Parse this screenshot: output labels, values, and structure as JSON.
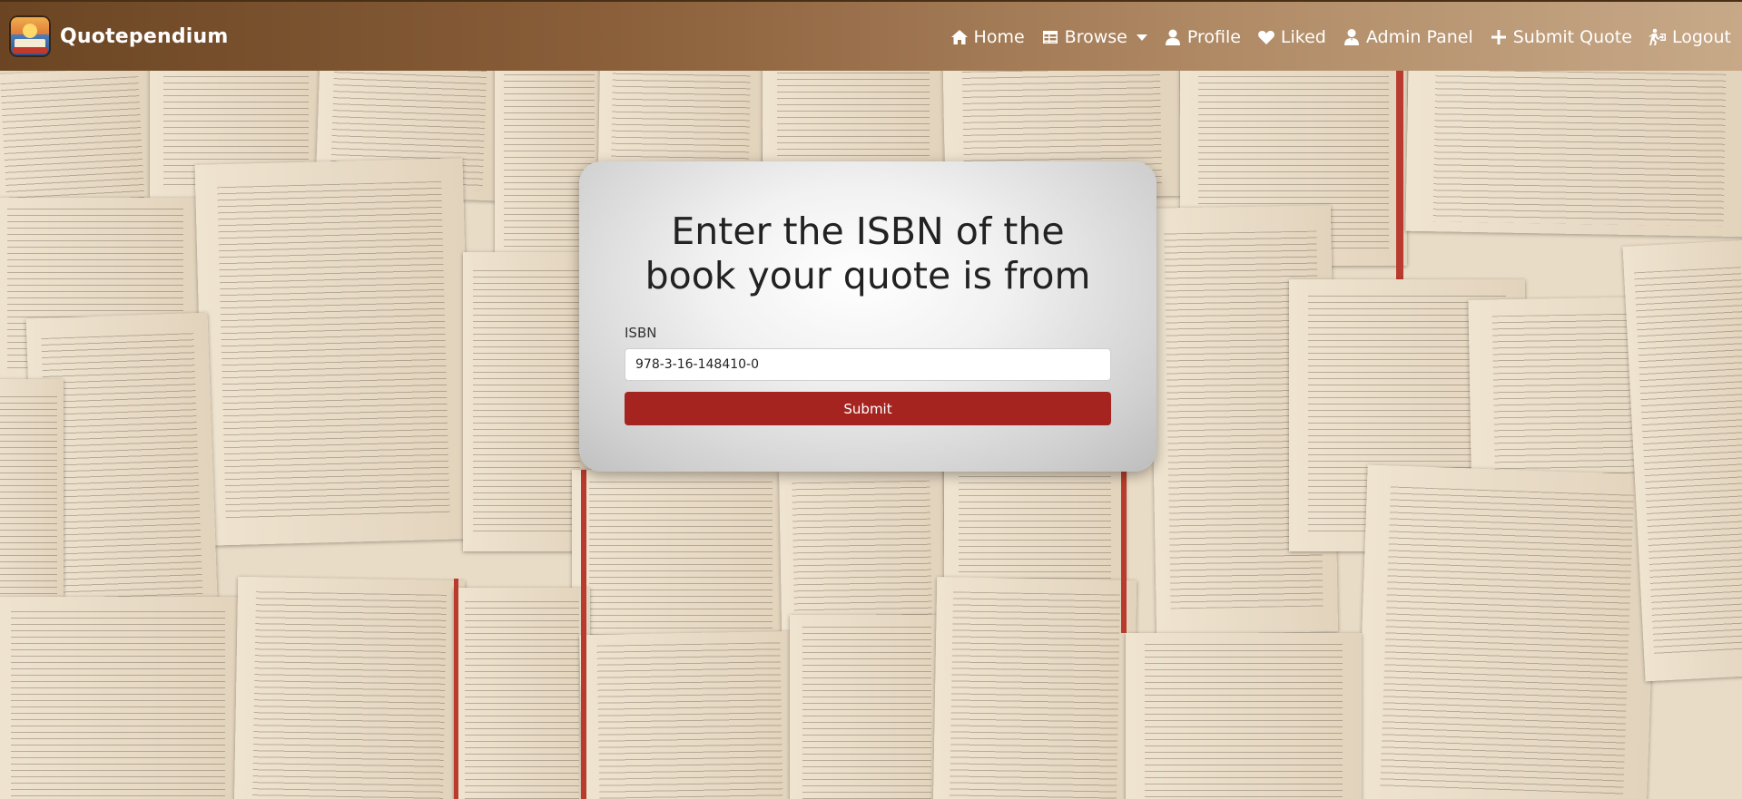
{
  "app": {
    "name": "Quotependium"
  },
  "nav": {
    "items": [
      {
        "label": "Home",
        "icon": "home-icon"
      },
      {
        "label": "Browse",
        "icon": "table-icon"
      },
      {
        "label": "Profile",
        "icon": "user-icon"
      },
      {
        "label": "Liked",
        "icon": "heart-icon"
      },
      {
        "label": "Admin Panel",
        "icon": "user-tie-icon"
      },
      {
        "label": "Submit Quote",
        "icon": "plus-icon"
      },
      {
        "label": "Logout",
        "icon": "logout-icon"
      }
    ]
  },
  "form": {
    "title": "Enter the ISBN of the book your quote is from",
    "isbn_label": "ISBN",
    "isbn_value": "978-3-16-148410-0",
    "submit_label": "Submit"
  },
  "colors": {
    "navbar": "#8a5f3a",
    "submit_button": "#a52420",
    "card": "#e6e6e6"
  }
}
